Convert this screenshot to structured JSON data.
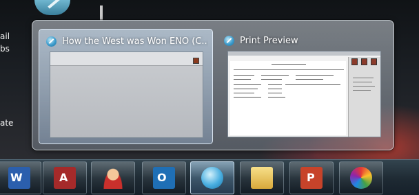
{
  "desktop": {
    "labels": [
      "ail",
      "bs",
      "ate"
    ]
  },
  "flyout": {
    "windows": [
      {
        "title": "How the West was Won ENO (C...",
        "icon": "app-globe-icon",
        "selected": true
      },
      {
        "title": "Print Preview",
        "icon": "app-globe-icon",
        "selected": false
      }
    ]
  },
  "taskbar": {
    "buttons": [
      {
        "name": "word",
        "icon": "word-icon"
      },
      {
        "name": "access",
        "icon": "access-icon"
      },
      {
        "name": "contact",
        "icon": "person-headset-icon"
      },
      {
        "name": "outlook",
        "icon": "outlook-icon"
      },
      {
        "name": "active-app",
        "icon": "app-globe-icon",
        "active": true
      },
      {
        "name": "explorer",
        "icon": "folder-icon"
      },
      {
        "name": "powerpoint",
        "icon": "powerpoint-icon"
      },
      {
        "name": "paint",
        "icon": "paint-palette-icon"
      }
    ]
  }
}
